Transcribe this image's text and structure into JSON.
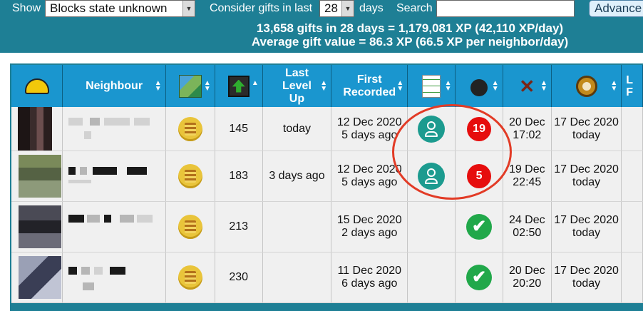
{
  "filters": {
    "show_label": "Show",
    "show_value": "Blocks state unknown",
    "consider_label": "Consider gifts in last",
    "days_value": "28",
    "days_label": "days",
    "search_label": "Search",
    "search_value": "",
    "advanced_label": "Advance"
  },
  "summary": {
    "line1": "13,658 gifts in 28 days = 1,179,081 XP (42,110 XP/day)",
    "line2": "Average gift value = 86.3 XP (66.5 XP per neighbor/day)"
  },
  "headers": {
    "neighbour": "Neighbour",
    "last_level_1": "Last",
    "last_level_2": "Level",
    "last_level_3": "Up",
    "first_recorded_1": "First",
    "first_recorded_2": "Recorded",
    "partial": "L\nF"
  },
  "icons": {
    "col1": "hard-hat-icon",
    "col3": "map-icon",
    "col4": "level-up-arrow-icon",
    "col7": "checklist-icon",
    "col8": "bomb-icon",
    "col9": "windmill-icon",
    "col10": "clock-icon"
  },
  "rows": [
    {
      "level": "145",
      "last_level": "today",
      "first_date": "12 Dec 2020",
      "first_ago": "5 days ago",
      "status": "person",
      "count": "19",
      "windmill_date": "20 Dec",
      "windmill_time": "17:02",
      "clock_date": "17 Dec 2020",
      "clock_ago": "today"
    },
    {
      "level": "183",
      "last_level": "3 days ago",
      "first_date": "12 Dec 2020",
      "first_ago": "5 days ago",
      "status": "person",
      "count": "5",
      "windmill_date": "19 Dec",
      "windmill_time": "22:45",
      "clock_date": "17 Dec 2020",
      "clock_ago": "today"
    },
    {
      "level": "213",
      "last_level": "",
      "first_date": "15 Dec 2020",
      "first_ago": "2 days ago",
      "status": "",
      "count": "✔",
      "windmill_date": "24 Dec",
      "windmill_time": "02:50",
      "clock_date": "17 Dec 2020",
      "clock_ago": "today"
    },
    {
      "level": "230",
      "last_level": "",
      "first_date": "11 Dec 2020",
      "first_ago": "6 days ago",
      "status": "",
      "count": "✔",
      "windmill_date": "20 Dec",
      "windmill_time": "20:20",
      "clock_date": "17 Dec 2020",
      "clock_ago": "today"
    }
  ],
  "colors": {
    "header_bg": "#1e7f95",
    "column_header": "#1a96cf",
    "highlight_circle": "#e23b26",
    "red_badge": "#e60d0d",
    "green_badge": "#21a84a"
  }
}
